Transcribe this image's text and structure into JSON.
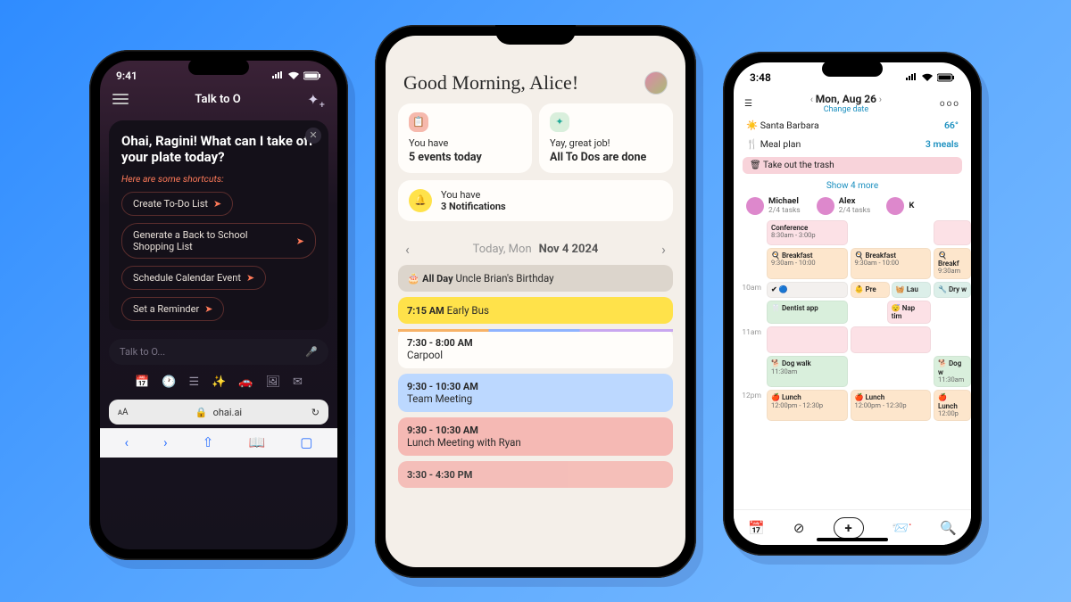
{
  "phone1": {
    "time": "9:41",
    "header_title": "Talk to O",
    "greeting": "Ohai, Ragini! What can I take off your plate today?",
    "subtitle": "Here are some shortcuts:",
    "shortcuts": [
      "Create To-Do List",
      "Generate a Back to School Shopping List",
      "Schedule Calendar Event",
      "Set a Reminder"
    ],
    "input_placeholder": "Talk to O...",
    "url": "ohai.ai",
    "url_prefix": "ᴀA"
  },
  "phone2": {
    "greeting": "Good Morning, Alice!",
    "card_events_pre": "You have",
    "card_events_main": "5 events today",
    "card_done_pre": "Yay, great job!",
    "card_done_main": "All To Dos are done",
    "notif_pre": "You have",
    "notif_main": "3 Notifications",
    "date_label": "Today, Mon",
    "date_value": "Nov  4  2024",
    "events": [
      {
        "time": "All Day",
        "title": "Uncle Brian's Birthday",
        "cls": "ev-allday"
      },
      {
        "time": "7:15 AM",
        "title": "Early Bus",
        "cls": "ev-yellow"
      },
      {
        "time": "7:30 - 8:00 AM",
        "title": "Carpool",
        "cls": "ev-white"
      },
      {
        "time": "9:30 - 10:30 AM",
        "title": "Team Meeting",
        "cls": "ev-blue"
      },
      {
        "time": "9:30 - 10:30 AM",
        "title": "Lunch Meeting with Ryan",
        "cls": "ev-pink"
      },
      {
        "time": "3:30 - 4:30 PM",
        "title": "",
        "cls": "ev-pink2"
      }
    ]
  },
  "phone3": {
    "time": "3:48",
    "title": "Mon, Aug 26",
    "subtitle": "Change date",
    "weather_loc": "Santa Barbara",
    "weather_temp": "66°",
    "meal_label": "Meal plan",
    "meal_count": "3 meals",
    "trash": "🗑 Take out the trash",
    "show_more": "Show 4 more",
    "people": [
      {
        "name": "Michael",
        "sub": "2/4 tasks"
      },
      {
        "name": "Alex",
        "sub": "2/4 tasks"
      },
      {
        "name": "K",
        "sub": ""
      }
    ],
    "hours": [
      "",
      "10am",
      "",
      "11am",
      "",
      "12pm"
    ],
    "cells": {
      "r0c1": {
        "t": "Conference",
        "d": "8:30am - 3:00p",
        "cls": "pk"
      },
      "r0c3": {
        "t": "",
        "d": "",
        "cls": "pk"
      },
      "r1c1": {
        "t": "🍳 Breakfast",
        "d": "9:30am - 10:00",
        "cls": "or"
      },
      "r1c2": {
        "t": "🍳 Breakfast",
        "d": "9:30am - 10:00",
        "cls": "or"
      },
      "r1c3": {
        "t": "🍳 Breakf",
        "d": "9:30am ",
        "cls": "or"
      },
      "r2c1": {
        "t": "✔ 🔵",
        "d": "",
        "cls": "gy"
      },
      "r2c2a": {
        "t": "👶 Pre",
        "d": "",
        "cls": "or"
      },
      "r2c2b": {
        "t": "🧺 Lau",
        "d": "",
        "cls": "bl"
      },
      "r2c3": {
        "t": "🔧 Dry w",
        "d": "",
        "cls": "bl"
      },
      "r3c1": {
        "t": "🦷 Dentist app",
        "d": "",
        "cls": "gn"
      },
      "r3c2": {
        "t": "😴 Nap tim",
        "d": "",
        "cls": "pk"
      },
      "r4c1": {
        "t": "🐕 Dog walk",
        "d": "11:30am",
        "cls": "gn"
      },
      "r4c3": {
        "t": "🐕 Dog w",
        "d": "11:30am",
        "cls": "gn"
      },
      "r5c1": {
        "t": "🍎 Lunch",
        "d": "12:00pm - 12:30p",
        "cls": "or"
      },
      "r5c2": {
        "t": "🍎 Lunch",
        "d": "12:00pm - 12:30p",
        "cls": "or"
      },
      "r5c3": {
        "t": "🍎 Lunch",
        "d": "12:00p",
        "cls": "or"
      }
    }
  }
}
